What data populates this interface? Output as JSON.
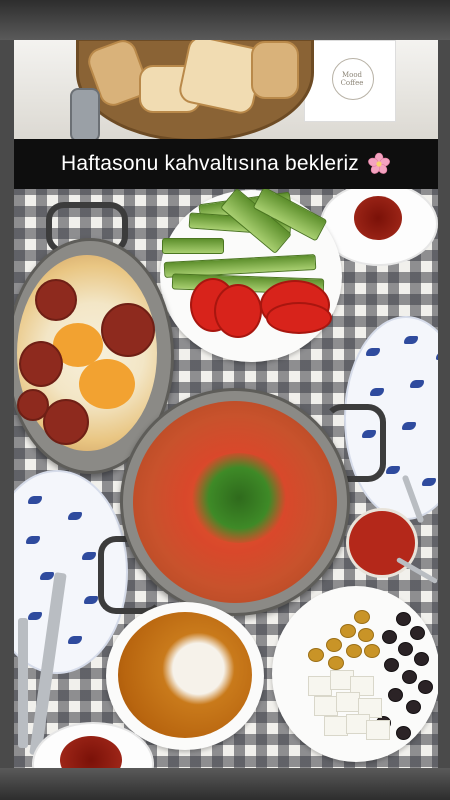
{
  "story": {
    "caption": "Haftasonu kahvaltısına bekleriz",
    "caption_icon": "cherry-blossom-icon",
    "logo_text": "Mood Coffee",
    "colors": {
      "caption_bg": "#0e0e0e",
      "caption_text": "#ffffff",
      "flower": "#f4a3c0",
      "tablecloth": "#3c3e46"
    }
  }
}
